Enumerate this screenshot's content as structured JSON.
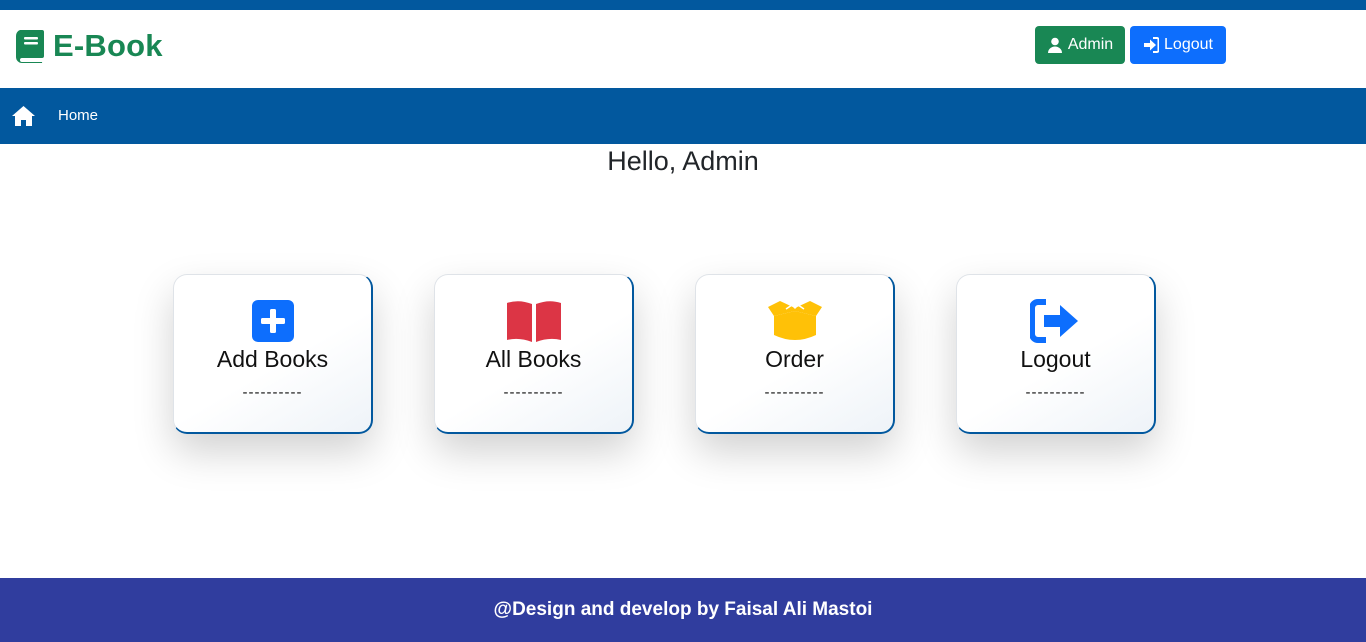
{
  "brand": {
    "name": "E-Book",
    "icon": "book-icon",
    "color": "#198754"
  },
  "header": {
    "admin_label": "Admin",
    "logout_label": "Logout",
    "admin_color": "#198754",
    "logout_color": "#0d6efd"
  },
  "nav": {
    "home_label": "Home",
    "bg_color": "#02589e"
  },
  "main": {
    "greeting": "Hello, Admin"
  },
  "cards": [
    {
      "title": "Add Books",
      "dash": "----------",
      "icon": "plus-square-icon",
      "color": "#0d6efd"
    },
    {
      "title": "All Books",
      "dash": "----------",
      "icon": "open-book-icon",
      "color": "#dc3545"
    },
    {
      "title": "Order",
      "dash": "----------",
      "icon": "open-box-icon",
      "color": "#ffc107"
    },
    {
      "title": "Logout",
      "dash": "----------",
      "icon": "sign-out-icon",
      "color": "#0d6efd"
    }
  ],
  "footer": {
    "text": "@Design and develop by Faisal Ali Mastoi",
    "bg_color": "#303d9e"
  }
}
